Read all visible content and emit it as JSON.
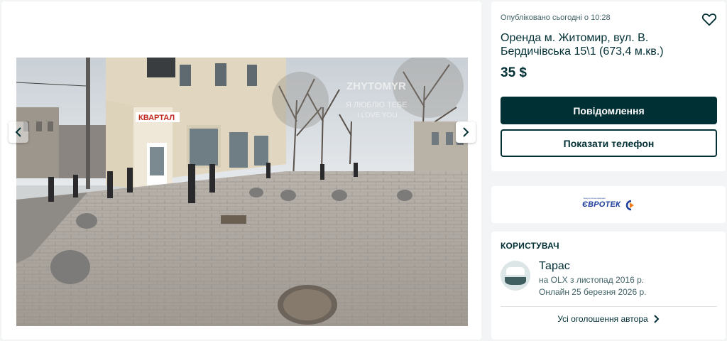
{
  "gallery": {
    "prev_icon": "chevron-left-icon",
    "next_icon": "chevron-right-icon",
    "photo_sign": "КВАРТАЛ",
    "photo_text_lines": [
      "ZHYTOMYR",
      "Я ЛЮБЛЮ ТЕБЕ",
      "I LOVE YOU"
    ]
  },
  "listing": {
    "published": "Опубліковано сьогодні о 10:28",
    "favorite_icon": "heart-icon",
    "title": "Оренда м. Житомир, вул. В. Бердичівська 15\\1 (673,4 м.кв.)",
    "price": "35 $",
    "message_button": "Повідомлення",
    "phone_button": "Показати телефон"
  },
  "company": {
    "logo_small_text": "Енергетична компанія",
    "logo_text": "ЄВРОТЕК"
  },
  "user": {
    "heading": "КОРИСТУВАЧ",
    "name": "Тарас",
    "since": "на OLX з листопад 2016 р.",
    "online": "Онлайн 25 березня 2026 р.",
    "all_ads_link": "Усі оголошення автора",
    "avatar_icon": "user-avatar-icon",
    "chevron_icon": "chevron-right-icon"
  },
  "colors": {
    "primary": "#002f34",
    "background": "#f2f4f5",
    "logo_blue": "#1d3f9a",
    "logo_orange": "#f07d1a"
  }
}
